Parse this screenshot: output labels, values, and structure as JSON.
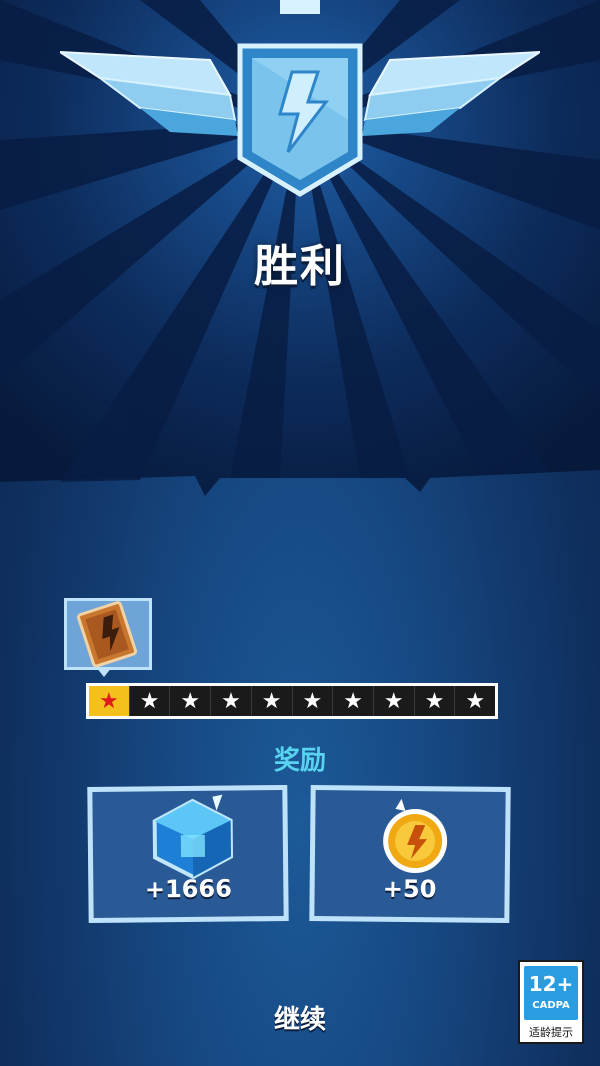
{
  "result": {
    "title": "胜利"
  },
  "progress": {
    "filled_stars": 1,
    "total_stars": 10,
    "star_symbol": "★",
    "filled_color": "#f4c11c",
    "filled_star_color": "#e01b1b"
  },
  "rewards": {
    "label": "奖励",
    "items": [
      {
        "icon": "blue-cube-gem-icon",
        "value": "+1666"
      },
      {
        "icon": "gold-lightning-coin-icon",
        "value": "+50"
      }
    ]
  },
  "continue_label": "继续",
  "age_rating": {
    "age": "12+",
    "org": "CADPA",
    "hint": "适龄提示"
  },
  "colors": {
    "accent": "#58d3ef",
    "card_border": "#bfe2fb",
    "card_fill": "#2a5a96"
  }
}
